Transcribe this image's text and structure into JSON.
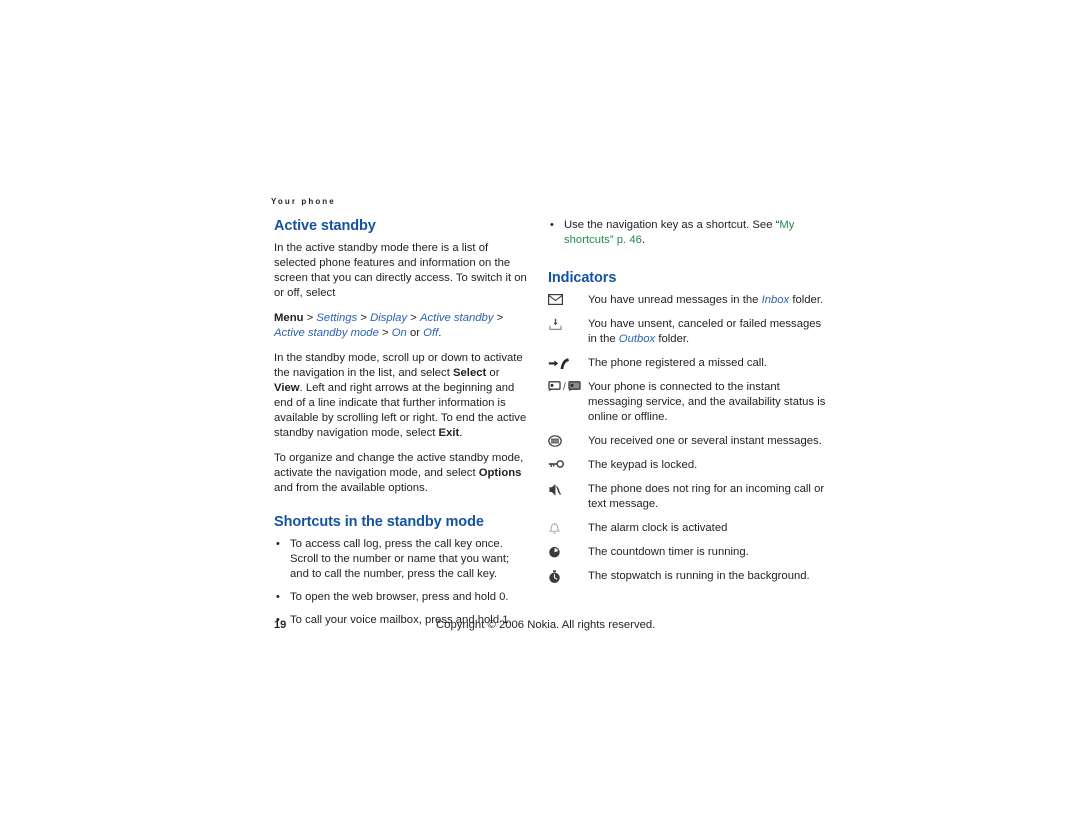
{
  "page": {
    "running_header": "Your phone",
    "footer_page_number": "19",
    "footer_copyright": "Copyright © 2006 Nokia. All rights reserved.",
    "heading_color": "#15539e",
    "crossref_color": "#1f8a4c",
    "italic_ref_color": "#2b62b0"
  },
  "left_column": {
    "active_standby": {
      "title": "Active standby",
      "para1": "In the active standby mode there is a list of selected phone features and information on the screen that you can directly access. To switch it on or off, select",
      "menu_path": {
        "menu_label": "Menu",
        "sep": " > ",
        "items": [
          "Settings",
          "Display",
          "Active standby",
          "Active standby mode"
        ],
        "tail_or": " or ",
        "option_on": "On",
        "option_off": "Off",
        "period": "."
      },
      "para2_pre": "In the standby mode, scroll up or down to activate the navigation in the list, and select ",
      "para2_select": "Select",
      "para2_or": " or ",
      "para2_view": "View",
      "para2_post": ". Left and right arrows at the beginning and end of a line indicate that further information is available by scrolling left or right. To end the active standby navigation mode, select ",
      "para2_exit": "Exit",
      "para2_end": ".",
      "para3_pre": "To organize and change the active standby mode, activate the navigation mode, and select ",
      "para3_options": "Options",
      "para3_post": " and from the available options."
    },
    "shortcuts": {
      "title": "Shortcuts in the standby mode",
      "items": [
        "To access call log, press the call key once. Scroll to the number or name that you want; and to call the number, press the call key.",
        "To open the web browser, press and hold 0.",
        "To call your voice mailbox, press and hold 1."
      ]
    }
  },
  "right_column": {
    "shortcut_bullet": {
      "pre": "Use the navigation key as a shortcut. See “",
      "link_line1": "My",
      "link_line2": "shortcuts",
      "mid": "” p. ",
      "page_ref": "46",
      "post": "."
    },
    "indicators": {
      "title": "Indicators",
      "rows": [
        {
          "icon": "envelope-icon",
          "text_pre": "You have unread messages in the ",
          "text_italic": "Inbox",
          "text_post": " folder."
        },
        {
          "icon": "outbox-tray-icon",
          "text_pre": "You have unsent, canceled or failed messages in the ",
          "text_italic": "Outbox",
          "text_post": " folder."
        },
        {
          "icon": "missed-call-icon",
          "text_pre": "The phone registered a missed call.",
          "text_italic": "",
          "text_post": ""
        },
        {
          "icon": "im-connected-icons",
          "text_pre": "Your phone is connected to the instant messaging service, and the availability status is online or offline.",
          "text_italic": "",
          "text_post": ""
        },
        {
          "icon": "im-message-icon",
          "text_pre": "You received one or several instant messages.",
          "text_italic": "",
          "text_post": ""
        },
        {
          "icon": "keypad-lock-icon",
          "text_pre": "The keypad is locked.",
          "text_italic": "",
          "text_post": ""
        },
        {
          "icon": "silent-mode-icon",
          "text_pre": "The phone does not ring for an incoming call or text message.",
          "text_italic": "",
          "text_post": ""
        },
        {
          "icon": "alarm-clock-icon",
          "text_pre": "The alarm clock is activated",
          "text_italic": "",
          "text_post": ""
        },
        {
          "icon": "countdown-timer-icon",
          "text_pre": "The countdown timer is running.",
          "text_italic": "",
          "text_post": ""
        },
        {
          "icon": "stopwatch-icon",
          "text_pre": "The stopwatch is running in the background.",
          "text_italic": "",
          "text_post": ""
        }
      ]
    }
  }
}
